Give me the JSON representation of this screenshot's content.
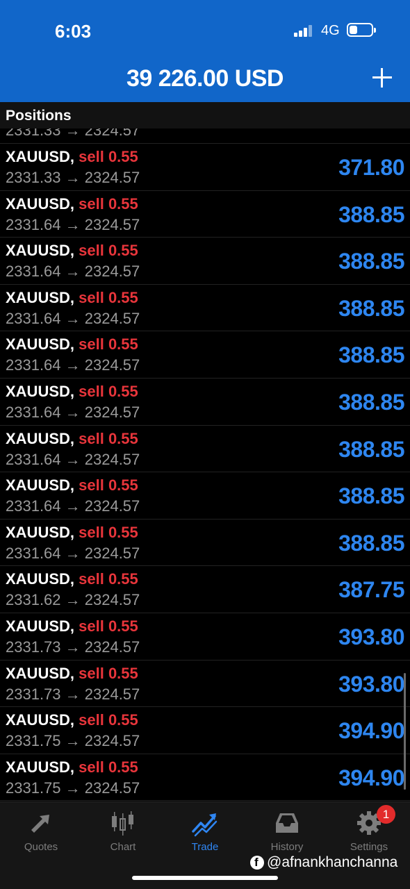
{
  "status": {
    "time": "6:03",
    "network": "4G"
  },
  "header": {
    "balance": "39 226.00 USD"
  },
  "section": {
    "title": "Positions"
  },
  "partial_row": {
    "prices": "2331.33 → 2324.57"
  },
  "positions": [
    {
      "symbol": "XAUUSD,",
      "side": "sell 0.55",
      "prices": "2331.33 → 2324.57",
      "profit": "371.80"
    },
    {
      "symbol": "XAUUSD,",
      "side": "sell 0.55",
      "prices": "2331.64 → 2324.57",
      "profit": "388.85"
    },
    {
      "symbol": "XAUUSD,",
      "side": "sell 0.55",
      "prices": "2331.64 → 2324.57",
      "profit": "388.85"
    },
    {
      "symbol": "XAUUSD,",
      "side": "sell 0.55",
      "prices": "2331.64 → 2324.57",
      "profit": "388.85"
    },
    {
      "symbol": "XAUUSD,",
      "side": "sell 0.55",
      "prices": "2331.64 → 2324.57",
      "profit": "388.85"
    },
    {
      "symbol": "XAUUSD,",
      "side": "sell 0.55",
      "prices": "2331.64 → 2324.57",
      "profit": "388.85"
    },
    {
      "symbol": "XAUUSD,",
      "side": "sell 0.55",
      "prices": "2331.64 → 2324.57",
      "profit": "388.85"
    },
    {
      "symbol": "XAUUSD,",
      "side": "sell 0.55",
      "prices": "2331.64 → 2324.57",
      "profit": "388.85"
    },
    {
      "symbol": "XAUUSD,",
      "side": "sell 0.55",
      "prices": "2331.64 → 2324.57",
      "profit": "388.85"
    },
    {
      "symbol": "XAUUSD,",
      "side": "sell 0.55",
      "prices": "2331.62 → 2324.57",
      "profit": "387.75"
    },
    {
      "symbol": "XAUUSD,",
      "side": "sell 0.55",
      "prices": "2331.73 → 2324.57",
      "profit": "393.80"
    },
    {
      "symbol": "XAUUSD,",
      "side": "sell 0.55",
      "prices": "2331.73 → 2324.57",
      "profit": "393.80"
    },
    {
      "symbol": "XAUUSD,",
      "side": "sell 0.55",
      "prices": "2331.75 → 2324.57",
      "profit": "394.90"
    },
    {
      "symbol": "XAUUSD,",
      "side": "sell 0.55",
      "prices": "2331.75 → 2324.57",
      "profit": "394.90"
    }
  ],
  "tabs": [
    {
      "label": "Quotes",
      "icon": "quotes-arrows-icon"
    },
    {
      "label": "Chart",
      "icon": "candlestick-icon"
    },
    {
      "label": "Trade",
      "icon": "trend-line-icon",
      "active": true
    },
    {
      "label": "History",
      "icon": "inbox-tray-icon"
    },
    {
      "label": "Settings",
      "icon": "gear-icon"
    }
  ],
  "settings_badge": "1",
  "watermark": {
    "handle": "@afnankhanchanna"
  },
  "colors": {
    "header_blue": "#1166c9",
    "sell_red": "#e8353b",
    "profit_blue": "#2e86f0",
    "active_tab": "#2f86f3"
  }
}
